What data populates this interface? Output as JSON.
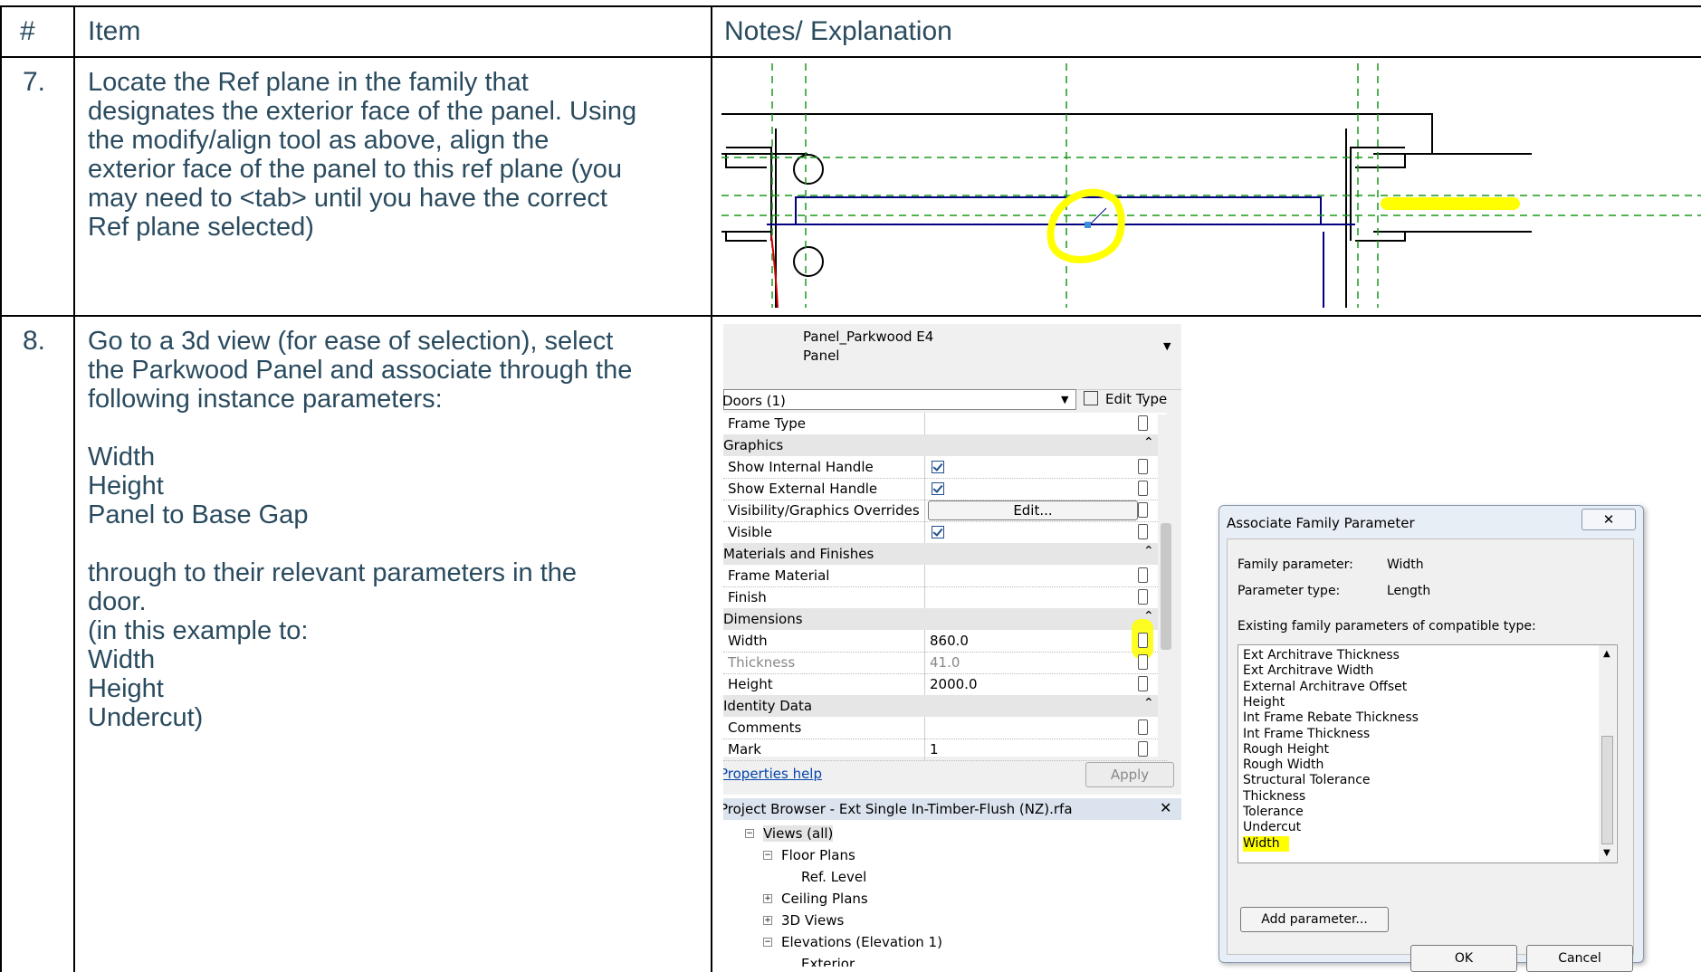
{
  "table": {
    "headers": {
      "num": "#",
      "item": "Item",
      "notes": "Notes/ Explanation"
    },
    "rows": [
      {
        "num": "7.",
        "item": "Locate the Ref plane in the family that\ndesignates the exterior face of the panel. Using\nthe modify/align tool as above, align the\nexterior face of the panel to this ref plane (you\nmay need to <tab> until you have the correct\nRef plane selected)"
      },
      {
        "num": "8.",
        "item": "Go to a 3d view (for ease of selection), select\nthe Parkwood Panel and associate through the\nfollowing instance parameters:\n\nWidth\nHeight\nPanel to Base Gap\n\nthrough to their relevant parameters in the\ndoor.\n(in this example to:\nWidth\nHeight\nUndercut)"
      }
    ]
  },
  "properties": {
    "type_name": "Panel_Parkwood E4",
    "type_sub": "Panel",
    "selector": "Doors (1)",
    "edit_type": "Edit Type",
    "edit_button": "Edit...",
    "rows": [
      {
        "kind": "prop",
        "name": "Frame Type",
        "value": ""
      },
      {
        "kind": "group",
        "name": "Graphics"
      },
      {
        "kind": "prop",
        "name": "Show Internal Handle",
        "check": true
      },
      {
        "kind": "prop",
        "name": "Show External Handle",
        "check": true
      },
      {
        "kind": "prop",
        "name": "Visibility/Graphics Overrides",
        "button": true
      },
      {
        "kind": "prop",
        "name": "Visible",
        "check": true
      },
      {
        "kind": "group",
        "name": "Materials and Finishes"
      },
      {
        "kind": "prop",
        "name": "Frame Material",
        "value": ""
      },
      {
        "kind": "prop",
        "name": "Finish",
        "value": ""
      },
      {
        "kind": "group",
        "name": "Dimensions"
      },
      {
        "kind": "prop",
        "name": "Width",
        "value": "860.0"
      },
      {
        "kind": "prop",
        "name": "Thickness",
        "value": "41.0",
        "disabled": true
      },
      {
        "kind": "prop",
        "name": "Height",
        "value": "2000.0"
      },
      {
        "kind": "group",
        "name": "Identity Data"
      },
      {
        "kind": "prop",
        "name": "Comments",
        "value": ""
      },
      {
        "kind": "prop",
        "name": "Mark",
        "value": "1"
      }
    ],
    "help_link": "Properties help",
    "apply": "Apply"
  },
  "project_browser": {
    "title": "Project Browser - Ext Single In-Timber-Flush (NZ).rfa",
    "items": [
      "Views (all)",
      "Floor Plans",
      "Ref. Level",
      "Ceiling Plans",
      "3D Views",
      "Elevations (Elevation 1)",
      "Exterior"
    ]
  },
  "dialog": {
    "title": "Associate Family Parameter",
    "family_param_label": "Family parameter:",
    "family_param_value": "Width",
    "param_type_label": "Parameter type:",
    "param_type_value": "Length",
    "list_label": "Existing family parameters of compatible type:",
    "items": [
      "Ext Architrave Thickness",
      "Ext Architrave Width",
      "External Architrave Offset",
      "Height",
      "Int Frame Rebate Thickness",
      "Int Frame Thickness",
      "Rough Height",
      "Rough Width",
      "Structural Tolerance",
      "Thickness",
      "Tolerance",
      "Undercut",
      "Width"
    ],
    "selected": "Width",
    "add_param": "Add parameter...",
    "ok": "OK",
    "cancel": "Cancel"
  },
  "colors": {
    "text": "#2a4b5f",
    "highlight": "#ffff00",
    "plan_blue": "#000080",
    "ref_green": "#1a9a1a"
  }
}
